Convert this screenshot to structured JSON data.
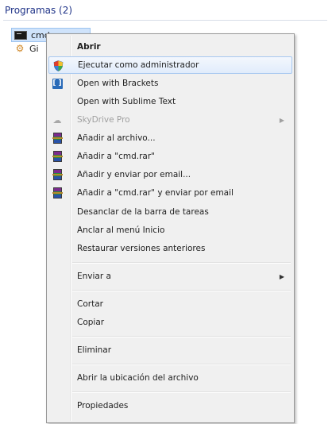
{
  "section": {
    "header": "Programas (2)"
  },
  "results": [
    {
      "label": "cmd",
      "icon": "cmd-icon"
    },
    {
      "label": "Gi",
      "icon": "gear-icon"
    }
  ],
  "context_menu": {
    "items": [
      {
        "label": "Abrir",
        "icon": "",
        "bold": true
      },
      {
        "label": "Ejecutar como administrador",
        "icon": "shield-icon",
        "hover": true
      },
      {
        "label": "Open with Brackets",
        "icon": "brackets-icon"
      },
      {
        "label": "Open with Sublime Text",
        "icon": ""
      },
      {
        "label": "SkyDrive Pro",
        "icon": "skydrive-icon",
        "disabled": true,
        "submenu": true
      },
      {
        "label": "Añadir al archivo...",
        "icon": "winrar-icon"
      },
      {
        "label": "Añadir a \"cmd.rar\"",
        "icon": "winrar-icon"
      },
      {
        "label": "Añadir y enviar por email...",
        "icon": "winrar-icon"
      },
      {
        "label": "Añadir a \"cmd.rar\" y enviar por email",
        "icon": "winrar-icon"
      },
      {
        "label": "Desanclar de la barra de tareas",
        "icon": ""
      },
      {
        "label": "Anclar al menú Inicio",
        "icon": ""
      },
      {
        "label": "Restaurar versiones anteriores",
        "icon": ""
      },
      {
        "label": "Enviar a",
        "icon": "",
        "submenu": true
      },
      {
        "label": "Cortar",
        "icon": ""
      },
      {
        "label": "Copiar",
        "icon": ""
      },
      {
        "label": "Eliminar",
        "icon": ""
      },
      {
        "label": "Abrir la ubicación del archivo",
        "icon": ""
      },
      {
        "label": "Propiedades",
        "icon": ""
      }
    ],
    "submenu_arrow": "▶"
  }
}
